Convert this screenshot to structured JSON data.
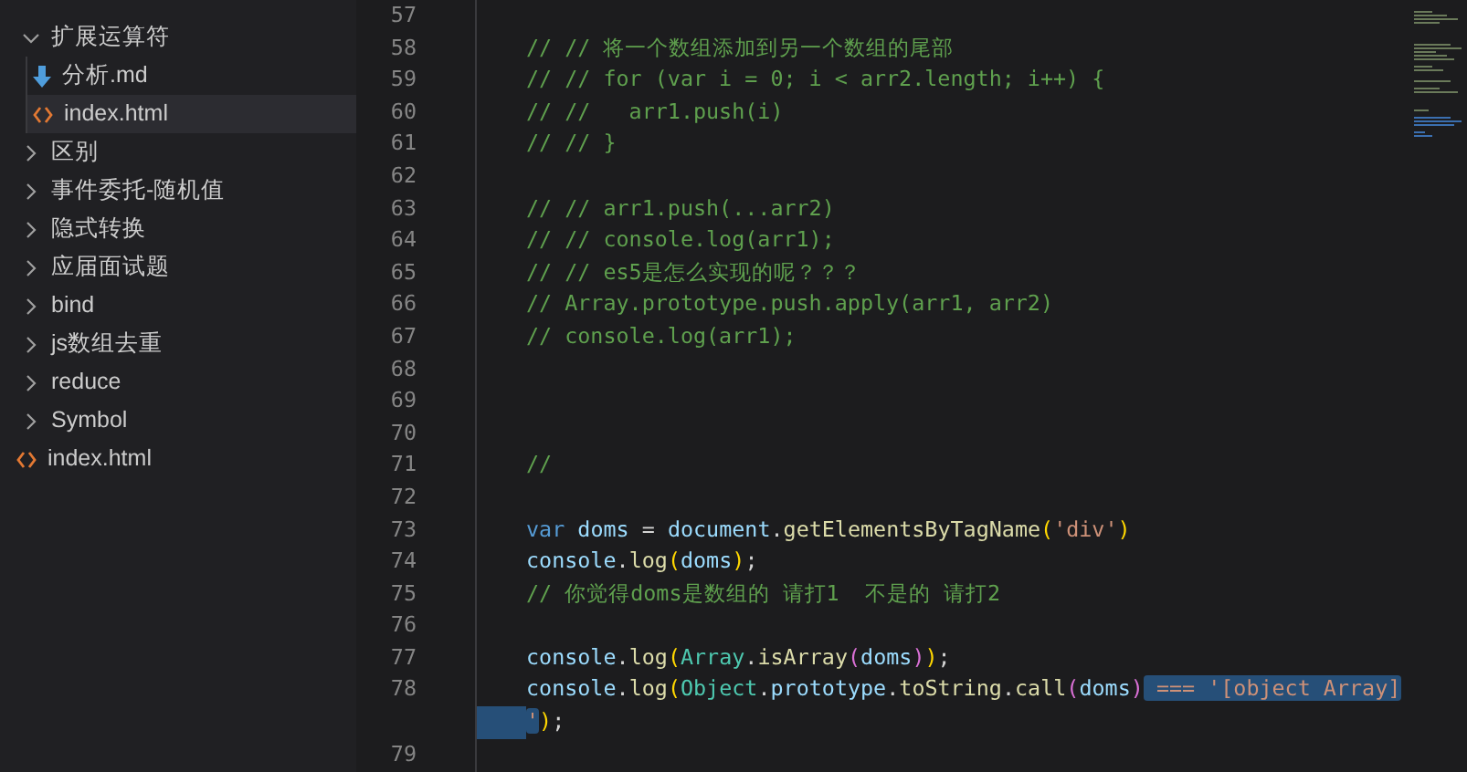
{
  "sidebar": {
    "items": [
      {
        "label": "扩展运算符",
        "kind": "folder",
        "expanded": true,
        "selected": false,
        "children": [
          {
            "label": "分析.md",
            "kind": "markdown",
            "selected": false
          },
          {
            "label": "index.html",
            "kind": "html",
            "selected": true
          }
        ]
      },
      {
        "label": "区别",
        "kind": "folder",
        "expanded": false,
        "selected": false
      },
      {
        "label": "事件委托-随机值",
        "kind": "folder",
        "expanded": false,
        "selected": false
      },
      {
        "label": "隐式转换",
        "kind": "folder",
        "expanded": false,
        "selected": false
      },
      {
        "label": "应届面试题",
        "kind": "folder",
        "expanded": false,
        "selected": false
      },
      {
        "label": "bind",
        "kind": "folder",
        "expanded": false,
        "selected": false
      },
      {
        "label": "js数组去重",
        "kind": "folder",
        "expanded": false,
        "selected": false
      },
      {
        "label": "reduce",
        "kind": "folder",
        "expanded": false,
        "selected": false
      },
      {
        "label": "Symbol",
        "kind": "folder",
        "expanded": false,
        "selected": false
      },
      {
        "label": "index.html",
        "kind": "html",
        "selected": false
      }
    ]
  },
  "editor": {
    "lines": [
      {
        "number": "57"
      },
      {
        "number": "58",
        "tokens": [
          {
            "text": "// // 将一个数组添加到另一个数组的尾部",
            "kind": "comment",
            "selected": false
          }
        ]
      },
      {
        "number": "59",
        "tokens": [
          {
            "text": "// // for (var i = 0; i < arr2.length; i++) {",
            "kind": "comment",
            "selected": false
          }
        ]
      },
      {
        "number": "60",
        "tokens": [
          {
            "text": "// //   arr1.push(i)",
            "kind": "comment",
            "selected": false
          }
        ]
      },
      {
        "number": "61",
        "tokens": [
          {
            "text": "// // }",
            "kind": "comment",
            "selected": false
          }
        ]
      },
      {
        "number": "62"
      },
      {
        "number": "63",
        "tokens": [
          {
            "text": "// // arr1.push(...arr2)",
            "kind": "comment",
            "selected": false
          }
        ]
      },
      {
        "number": "64",
        "tokens": [
          {
            "text": "// // console.log(arr1);",
            "kind": "comment",
            "selected": false
          }
        ]
      },
      {
        "number": "65",
        "tokens": [
          {
            "text": "// // es5是怎么实现的呢？？？",
            "kind": "comment",
            "selected": false
          }
        ]
      },
      {
        "number": "66",
        "tokens": [
          {
            "text": "// Array.prototype.push.apply(arr1, arr2)",
            "kind": "comment",
            "selected": false
          }
        ]
      },
      {
        "number": "67",
        "tokens": [
          {
            "text": "// console.log(arr1);",
            "kind": "comment",
            "selected": false
          }
        ]
      },
      {
        "number": "68"
      },
      {
        "number": "69"
      },
      {
        "number": "70"
      },
      {
        "number": "71",
        "tokens": [
          {
            "text": "//",
            "kind": "comment",
            "selected": false
          }
        ]
      },
      {
        "number": "72"
      },
      {
        "number": "73",
        "tokens": [
          {
            "text": "var",
            "kind": "keyword",
            "selected": false
          },
          {
            "text": " doms",
            "kind": "variable",
            "selected": false
          },
          {
            "text": " = ",
            "kind": "punct",
            "selected": false
          },
          {
            "text": "document",
            "kind": "variable",
            "selected": false
          },
          {
            "text": ".",
            "kind": "punct",
            "selected": false
          },
          {
            "text": "getElementsByTagName",
            "kind": "function",
            "selected": false
          },
          {
            "text": "(",
            "kind": "bracket1",
            "selected": false
          },
          {
            "text": "'div'",
            "kind": "string",
            "selected": false
          },
          {
            "text": ")",
            "kind": "bracket1",
            "selected": false
          }
        ]
      },
      {
        "number": "74",
        "tokens": [
          {
            "text": "console",
            "kind": "variable",
            "selected": false
          },
          {
            "text": ".",
            "kind": "punct",
            "selected": false
          },
          {
            "text": "log",
            "kind": "function",
            "selected": false
          },
          {
            "text": "(",
            "kind": "bracket1",
            "selected": false
          },
          {
            "text": "doms",
            "kind": "variable",
            "selected": false
          },
          {
            "text": ")",
            "kind": "bracket1",
            "selected": false
          },
          {
            "text": ";",
            "kind": "punct",
            "selected": false
          }
        ]
      },
      {
        "number": "75",
        "tokens": [
          {
            "text": "// 你觉得doms是数组的 请打1  不是的 请打2",
            "kind": "comment",
            "selected": false
          }
        ]
      },
      {
        "number": "76"
      },
      {
        "number": "77",
        "tokens": [
          {
            "text": "console",
            "kind": "variable",
            "selected": false
          },
          {
            "text": ".",
            "kind": "punct",
            "selected": false
          },
          {
            "text": "log",
            "kind": "function",
            "selected": false
          },
          {
            "text": "(",
            "kind": "bracket1",
            "selected": false
          },
          {
            "text": "Array",
            "kind": "class",
            "selected": false
          },
          {
            "text": ".",
            "kind": "punct",
            "selected": false
          },
          {
            "text": "isArray",
            "kind": "function",
            "selected": false
          },
          {
            "text": "(",
            "kind": "bracket2",
            "selected": false
          },
          {
            "text": "doms",
            "kind": "variable",
            "selected": false
          },
          {
            "text": ")",
            "kind": "bracket2",
            "selected": false
          },
          {
            "text": ")",
            "kind": "bracket1",
            "selected": false
          },
          {
            "text": ";",
            "kind": "punct",
            "selected": false
          }
        ]
      },
      {
        "number": "78",
        "tokens": [
          {
            "text": "console",
            "kind": "variable",
            "selected": false
          },
          {
            "text": ".",
            "kind": "punct",
            "selected": false
          },
          {
            "text": "log",
            "kind": "function",
            "selected": false
          },
          {
            "text": "(",
            "kind": "bracket1",
            "selected": false
          },
          {
            "text": "Object",
            "kind": "class",
            "selected": false
          },
          {
            "text": ".",
            "kind": "punct",
            "selected": false
          },
          {
            "text": "prototype",
            "kind": "variable",
            "selected": false
          },
          {
            "text": ".",
            "kind": "punct",
            "selected": false
          },
          {
            "text": "toString",
            "kind": "function",
            "selected": false
          },
          {
            "text": ".",
            "kind": "punct",
            "selected": false
          },
          {
            "text": "call",
            "kind": "function",
            "selected": false
          },
          {
            "text": "(",
            "kind": "bracket2",
            "selected": false
          },
          {
            "text": "doms",
            "kind": "variable",
            "selected": false
          },
          {
            "text": ")",
            "kind": "bracket2",
            "selected": false
          },
          {
            "text": " === '[object Array]",
            "kind": "string",
            "selected": true
          }
        ],
        "wrap": [
          {
            "text": "'",
            "kind": "string",
            "selected": true
          },
          {
            "text": ")",
            "kind": "bracket1",
            "selected": false
          },
          {
            "text": ";",
            "kind": "punct",
            "selected": false
          }
        ]
      },
      {
        "number": "79"
      }
    ]
  }
}
